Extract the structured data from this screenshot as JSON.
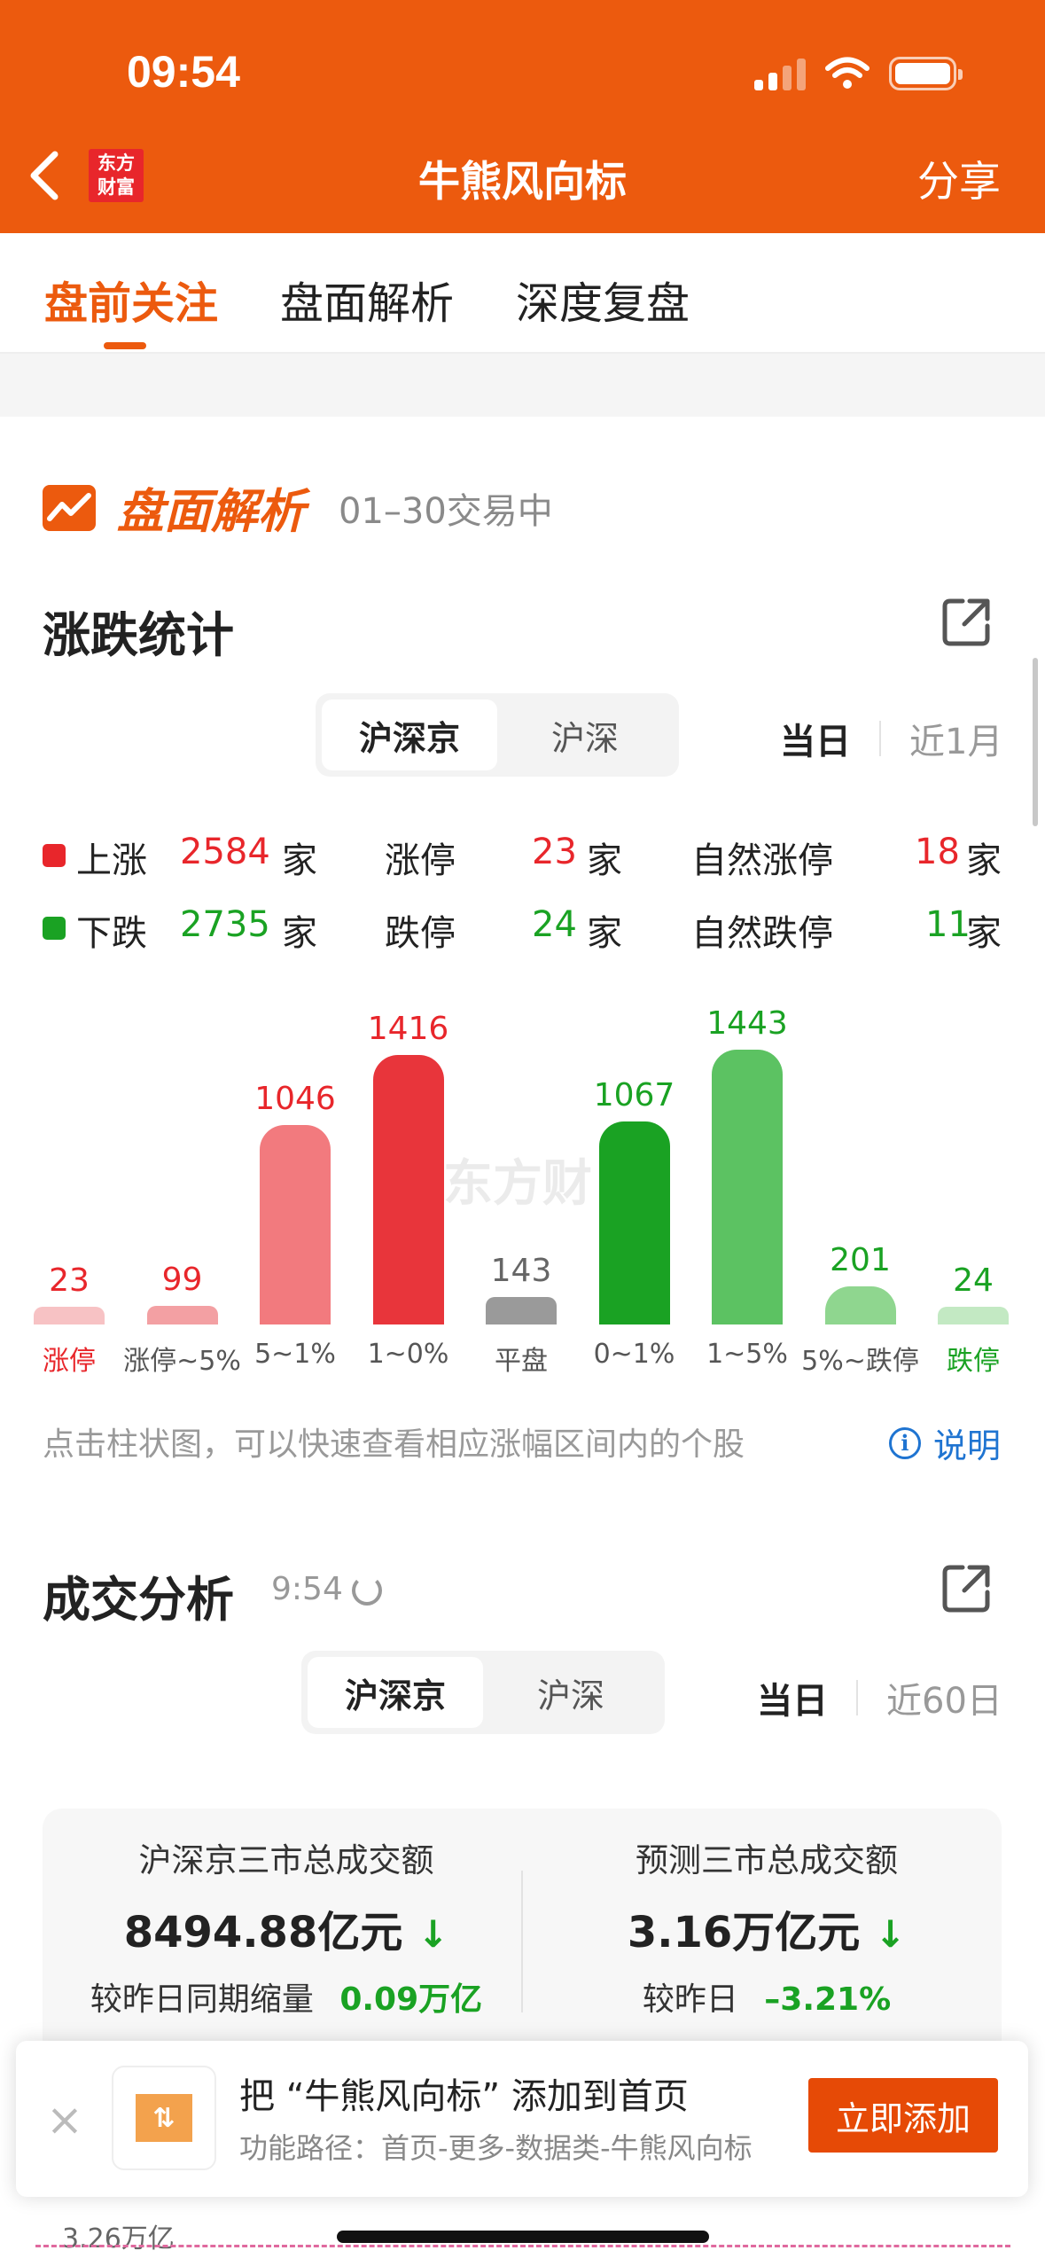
{
  "status_bar": {
    "time": "09:54"
  },
  "nav": {
    "logo_line1": "东方",
    "logo_line2": "财富",
    "title": "牛熊风向标",
    "share": "分享"
  },
  "tabs": [
    "盘前关注",
    "盘面解析",
    "深度复盘"
  ],
  "section": {
    "brand": "盘面解析",
    "subtitle": "01–30交易中"
  },
  "updown": {
    "title": "涨跌统计",
    "markets": [
      "沪深京",
      "沪深"
    ],
    "ranges": [
      "当日",
      "近1月"
    ],
    "rise": {
      "label": "上涨",
      "count": "2584",
      "unit": "家",
      "limit_label": "涨停",
      "limit_count": "23",
      "natural_label": "自然涨停",
      "natural_count": "18"
    },
    "fall": {
      "label": "下跌",
      "count": "2735",
      "unit": "家",
      "limit_label": "跌停",
      "limit_count": "24",
      "natural_label": "自然跌停",
      "natural_count": "11"
    },
    "hint": "点击柱状图，可以快速查看相应涨幅区间内的个股",
    "explain": "说明",
    "watermark": "东方财"
  },
  "chart_data": {
    "type": "bar",
    "categories": [
      "涨停",
      "涨停~5%",
      "5~1%",
      "1~0%",
      "平盘",
      "0~1%",
      "1~5%",
      "5%~跌停",
      "跌停"
    ],
    "values": [
      23,
      99,
      1046,
      1416,
      143,
      1067,
      1443,
      201,
      24
    ],
    "colors": [
      "#f7c2c4",
      "#f3a0a3",
      "#f27a7e",
      "#e8353b",
      "#9a9a9a",
      "#1aa223",
      "#5cc262",
      "#8fd68f",
      "#c3e9c3"
    ],
    "value_colors": [
      "#e8262b",
      "#e8262b",
      "#e8262b",
      "#e8262b",
      "#666666",
      "#1aa223",
      "#1aa223",
      "#1aa223",
      "#1aa223"
    ],
    "label_colors": [
      "#e8262b",
      "#555555",
      "#555555",
      "#555555",
      "#555555",
      "#555555",
      "#555555",
      "#555555",
      "#1aa223"
    ]
  },
  "volume": {
    "title": "成交分析",
    "time": "9:54",
    "markets": [
      "沪深京",
      "沪深"
    ],
    "ranges": [
      "当日",
      "近60日"
    ],
    "left": {
      "title": "沪深京三市总成交额",
      "amount": "8494.88亿元",
      "compare_label": "较昨日同期缩量",
      "compare_value": "0.09万亿"
    },
    "right": {
      "title": "预测三市总成交额",
      "amount": "3.16万亿元",
      "compare_label": "较昨日",
      "compare_value": "–3.21%"
    },
    "axis_top": "3.26万亿"
  },
  "banner": {
    "title": "把 “牛熊风向标” 添加到首页",
    "sub": "功能路径：首页-更多-数据类-牛熊风向标",
    "button": "立即添加",
    "close": "×"
  }
}
